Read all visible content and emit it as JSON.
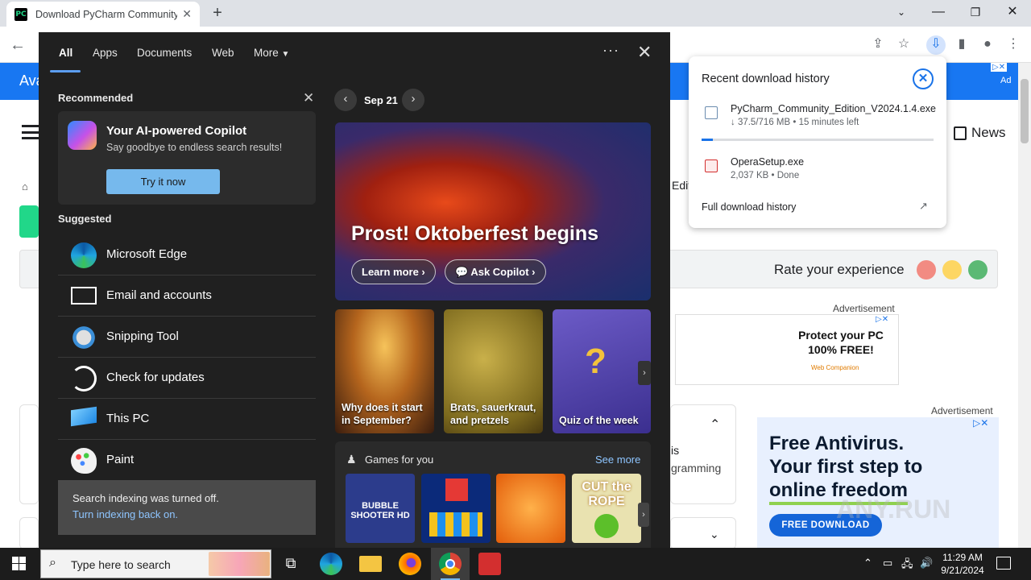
{
  "browser": {
    "tab_title": "Download PyCharm Community",
    "page": {
      "banner_text": "Ava",
      "news_label": "News",
      "rate_label": "Rate your experience",
      "ad_label_1": "Advertisement",
      "ad_label_2": "Advertisement",
      "ad1_text": "Protect your PC 100% FREE!",
      "ad1_brand": "Web Companion",
      "ad1_badge": "Ad",
      "ad2_headline_1": "Free Antivirus.",
      "ad2_headline_2": "Your first step to",
      "ad2_headline_3": "online freedom",
      "ad2_button": "FREE DOWNLOAD",
      "ad2_watermark": "ANY.RUN",
      "edit_fragment": "Edit",
      "fragment_is": "is",
      "fragment_gramming": "gramming"
    },
    "downloads": {
      "header": "Recent download history",
      "items": [
        {
          "name": "PyCharm_Community_Edition_V2024.1.4.exe",
          "status": "↓ 37.5/716 MB • 15 minutes left",
          "progress": 0.05
        },
        {
          "name": "OperaSetup.exe",
          "status": "2,037 KB • Done"
        }
      ],
      "full_history": "Full download history"
    }
  },
  "start_menu": {
    "tabs": [
      "All",
      "Apps",
      "Documents",
      "Web",
      "More"
    ],
    "recommended_label": "Recommended",
    "copilot_title": "Your AI-powered Copilot",
    "copilot_text": "Say goodbye to endless search results!",
    "copilot_button": "Try it now",
    "suggested_label": "Suggested",
    "apps": [
      "Microsoft Edge",
      "Email and accounts",
      "Snipping Tool",
      "Check for updates",
      "This PC",
      "Paint"
    ],
    "indexing_text": "Search indexing was turned off.",
    "indexing_link": "Turn indexing back on.",
    "date": "Sep 21",
    "hero_title": "Prost! Oktoberfest begins",
    "hero_learn": "Learn more",
    "hero_copilot": "Ask Copilot",
    "tiles": [
      "Why does it start in September?",
      "Brats, sauerkraut, and pretzels",
      "Quiz of the week"
    ],
    "games_label": "Games for you",
    "games_see_more": "See more",
    "game_titles": [
      "BUBBLE SHOOTER HD",
      "CUT the ROPE"
    ]
  },
  "taskbar": {
    "search_placeholder": "Type here to search",
    "time": "11:29 AM",
    "date": "9/21/2024"
  },
  "colors": {
    "accent": "#1a73e8",
    "start_bg": "#202020",
    "banner": "#1877f2"
  }
}
